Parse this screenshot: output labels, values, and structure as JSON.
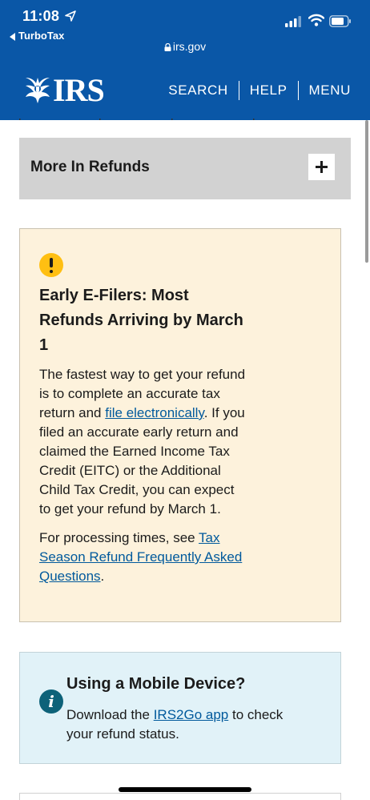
{
  "status_bar": {
    "time": "11:08",
    "back_app": "TurboTax",
    "url": "irs.gov",
    "icons": [
      "location-arrow-icon",
      "signal-icon",
      "wifi-icon",
      "battery-icon",
      "lock-icon"
    ]
  },
  "header": {
    "logo_text": "IRS",
    "nav": [
      "SEARCH",
      "HELP",
      "MENU"
    ]
  },
  "accordion": {
    "title": "More In Refunds",
    "expanded": false,
    "toggle_icon": "plus-icon"
  },
  "warning_alert": {
    "icon": "exclamation-icon",
    "heading": "Early E-Filers: Most Refunds Arriving by March 1",
    "p1_part1": "The fastest way to get your refund is to complete an accurate tax return and ",
    "p1_link": "file electronically",
    "p1_part2": ". If you filed an accurate early return and claimed the Earned Income Tax Credit (EITC) or the Additional Child Tax Credit, you can expect to get your refund by March 1.",
    "p2_part1": "For processing times, see ",
    "p2_link": "Tax Season Refund Frequently Asked Questions",
    "p2_part2": "."
  },
  "info_alert": {
    "icon": "info-icon",
    "heading": "Using a Mobile Device?",
    "body_part1": "Download the ",
    "body_link": "IRS2Go app",
    "body_part2": " to check your refund status."
  },
  "colors": {
    "brand_blue": "#0a57a7",
    "link": "#00599c",
    "warning_bg": "#fdf2dc",
    "warning_icon": "#ffbf12",
    "info_bg": "#e1f2f8",
    "info_icon": "#0d6279",
    "accordion_bg": "#d2d2d2"
  }
}
